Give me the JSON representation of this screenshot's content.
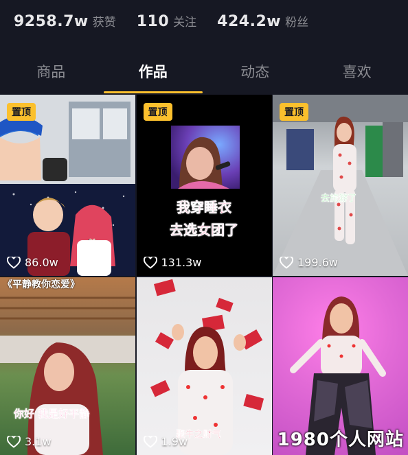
{
  "stats": [
    {
      "value": "9258.7w",
      "label": "获赞"
    },
    {
      "value": "110",
      "label": "关注"
    },
    {
      "value": "424.2w",
      "label": "粉丝"
    }
  ],
  "tabs": [
    "商品",
    "作品",
    "动态",
    "喜欢"
  ],
  "active_tab": "作品",
  "pinned_label": "置顶",
  "videos": [
    {
      "likes": "86.0w",
      "pinned": true,
      "caption": ""
    },
    {
      "likes": "131.3w",
      "pinned": true,
      "caption_line1": "我穿睡衣",
      "caption_line2": "去选女团了"
    },
    {
      "likes": "199.6w",
      "pinned": true,
      "caption": "去旅游了"
    },
    {
      "likes": "3.1w",
      "pinned": false,
      "caption": "你好 我是好平静",
      "top_text": "《平静教你恋爱》"
    },
    {
      "likes": "1.9w",
      "pinned": false,
      "caption": "聚牛之财气"
    },
    {
      "likes": "",
      "pinned": false,
      "caption": ""
    }
  ],
  "watermark": "1980个人网站",
  "colors": {
    "background": "#161823",
    "accent": "#fbc02d"
  }
}
